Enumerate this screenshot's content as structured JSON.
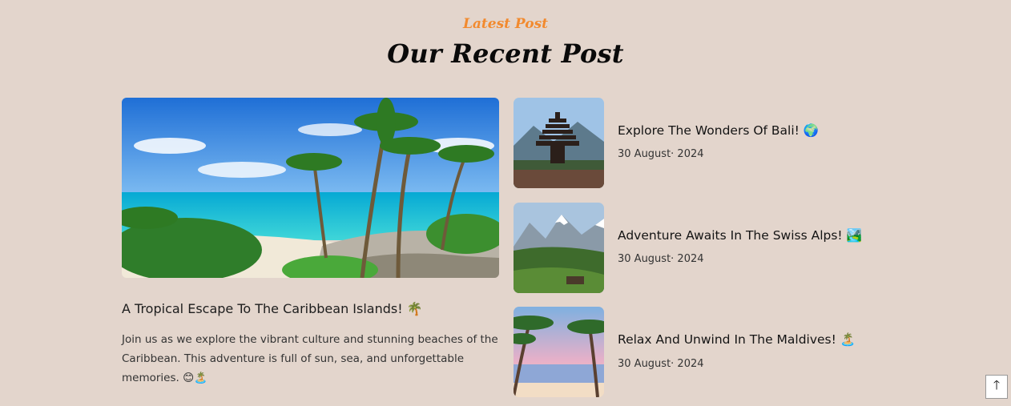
{
  "section": {
    "eyebrow": "Latest Post",
    "title": "Our Recent Post"
  },
  "featured_post": {
    "title": "A Tropical Escape To The Caribbean Islands! 🌴",
    "excerpt": "Join us as we explore the vibrant culture and stunning beaches of the Caribbean. This adventure is full of sun, sea, and unforgettable memories. 😊🏝️",
    "image": "caribbean-beach-photo"
  },
  "posts": [
    {
      "title": "Explore The Wonders Of Bali! 🌍",
      "date": "30 August· 2024",
      "image": "bali-temple-photo"
    },
    {
      "title": "Adventure Awaits In The Swiss Alps! 🏞️",
      "date": "30 August· 2024",
      "image": "swiss-alps-photo"
    },
    {
      "title": "Relax And Unwind In The Maldives! 🏝️",
      "date": "30 August· 2024",
      "image": "maldives-beach-photo"
    }
  ],
  "scroll_top": {
    "icon": "arrow-up-icon",
    "glyph": "🡑"
  },
  "colors": {
    "background": "#e3d5cc",
    "accent": "#f28a2e"
  }
}
